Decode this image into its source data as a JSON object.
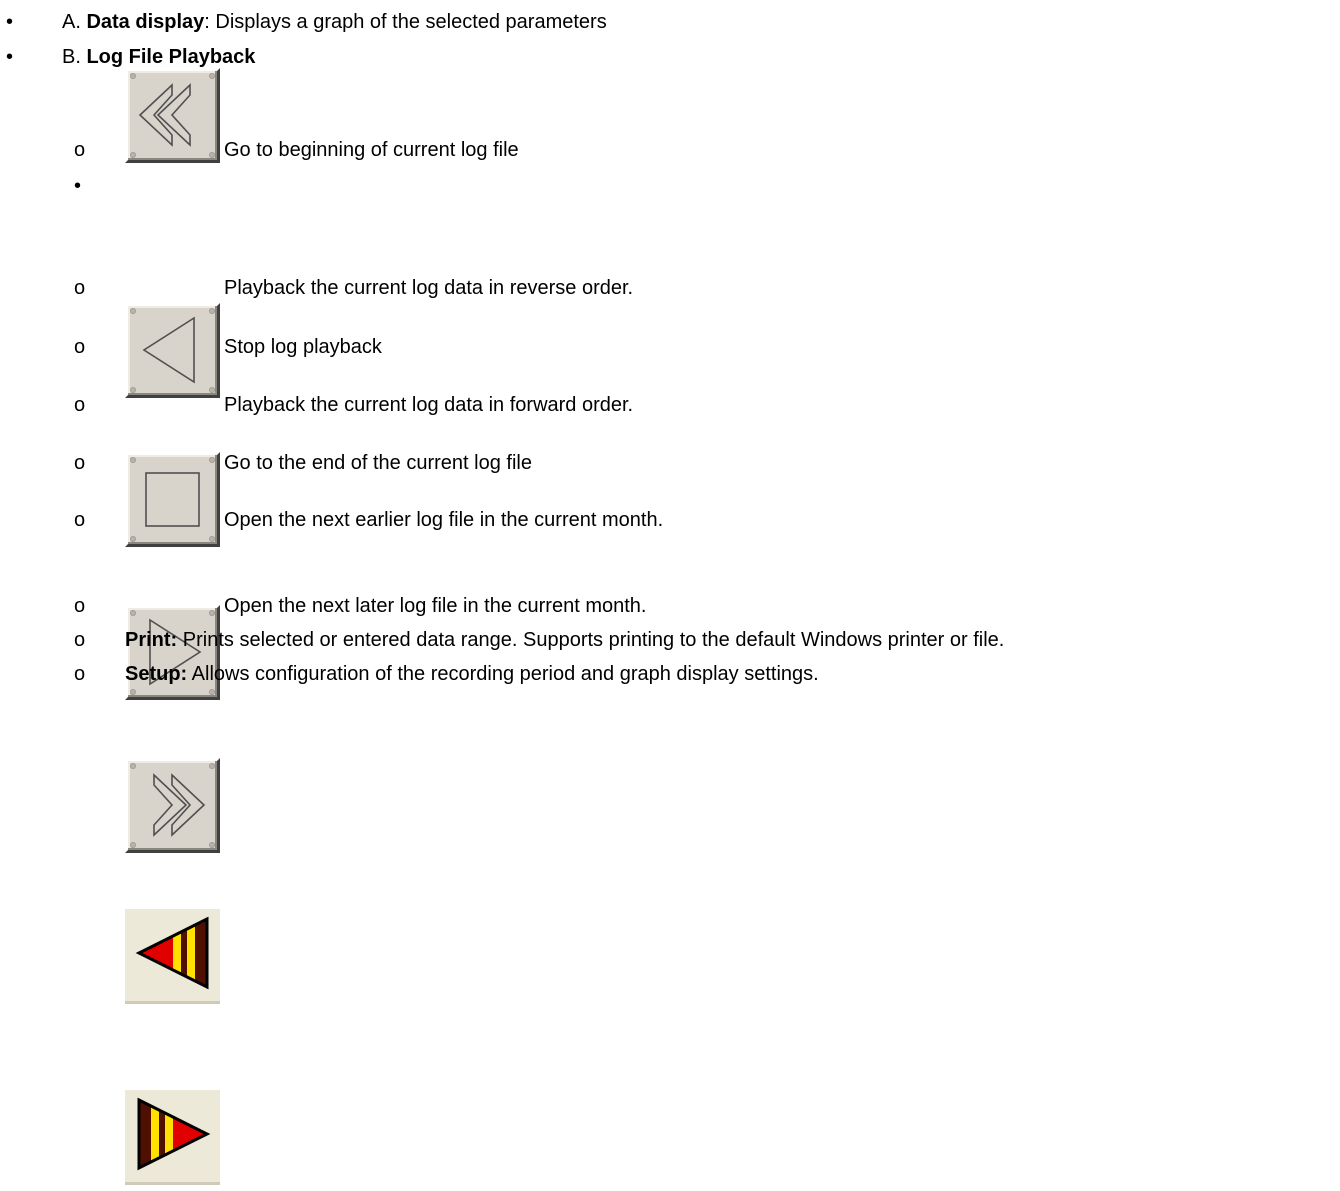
{
  "bullet_glyph": "•",
  "sub_glyph": "o",
  "item_a": {
    "prefix": "A. ",
    "title": "Data display",
    "text": ": Displays a graph of the selected parameters"
  },
  "item_b": {
    "prefix": "B. ",
    "title": "Log File Playback"
  },
  "playback": [
    {
      "icon": "rewind-to-start-icon",
      "text": "Go to beginning of current log file"
    },
    {
      "icon": "play-reverse-icon",
      "text": "Playback the current log data in reverse order."
    },
    {
      "icon": "stop-icon",
      "text": "Stop log playback"
    },
    {
      "icon": "play-forward-icon",
      "text": "Playback the current log data in forward order."
    },
    {
      "icon": "fast-forward-to-end-icon",
      "text": "Go to the end of the current log file"
    },
    {
      "icon": "previous-log-file-icon",
      "text": "Open the next earlier log file in the current month."
    },
    {
      "icon": "next-log-file-icon",
      "text": "Open the next later log file in the current month."
    }
  ],
  "print": {
    "label": "Print:",
    "text": " Prints selected or entered data range. Supports printing to the default Windows printer or file."
  },
  "setup": {
    "label": "Setup:",
    "text": " Allows configuration of the recording period and graph display settings."
  },
  "colors": {
    "arrow_red": "#e00000",
    "stripe_yellow": "#ffe000",
    "stripe_dark": "#501000",
    "button_face": "#d8d4cc"
  }
}
